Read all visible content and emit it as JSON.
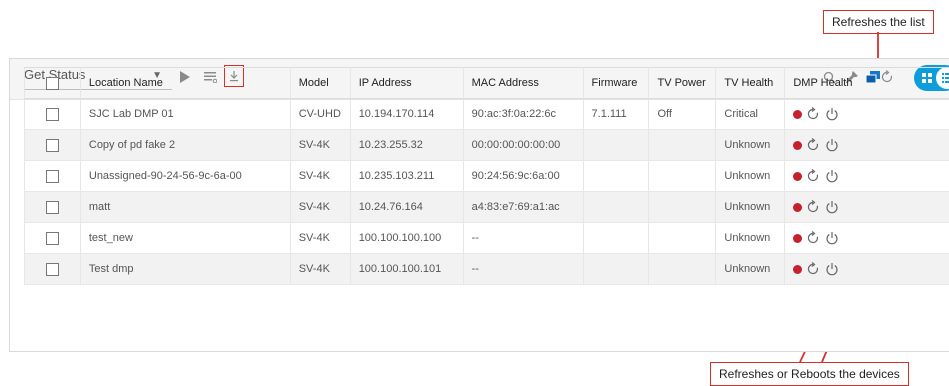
{
  "annotations": {
    "top": "Refreshes the list",
    "bottom": "Refreshes or Reboots the devices"
  },
  "toolbar": {
    "action_select": "Get Status",
    "icons": [
      "play-icon",
      "list-icon",
      "export-icon",
      "search-icon",
      "pin-icon",
      "window-icon",
      "refresh-icon",
      "grid-view-icon",
      "list-view-icon"
    ],
    "accent_color": "#0d9ddb",
    "highlight_color": "#d4312a"
  },
  "table": {
    "columns": [
      "Location Name",
      "Model",
      "IP Address",
      "MAC Address",
      "Firmware",
      "TV Power",
      "TV Health",
      "DMP Health"
    ],
    "rows": [
      {
        "location": "SJC Lab DMP 01",
        "model": "CV-UHD",
        "ip": "10.194.170.114",
        "mac": "90:ac:3f:0a:22:6c",
        "firmware": "7.1.111",
        "tv_power": "Off",
        "tv_health": "Critical"
      },
      {
        "location": "Copy of pd fake 2",
        "model": "SV-4K",
        "ip": "10.23.255.32",
        "mac": "00:00:00:00:00:00",
        "firmware": "",
        "tv_power": "",
        "tv_health": "Unknown"
      },
      {
        "location": "Unassigned-90-24-56-9c-6a-00",
        "model": "SV-4K",
        "ip": "10.235.103.211",
        "mac": "90:24:56:9c:6a:00",
        "firmware": "",
        "tv_power": "",
        "tv_health": "Unknown"
      },
      {
        "location": "matt",
        "model": "SV-4K",
        "ip": "10.24.76.164",
        "mac": "a4:83:e7:69:a1:ac",
        "firmware": "",
        "tv_power": "",
        "tv_health": "Unknown"
      },
      {
        "location": "test_new",
        "model": "SV-4K",
        "ip": "100.100.100.100",
        "mac": "--",
        "firmware": "",
        "tv_power": "",
        "tv_health": "Unknown"
      },
      {
        "location": "Test dmp",
        "model": "SV-4K",
        "ip": "100.100.100.101",
        "mac": "--",
        "firmware": "",
        "tv_power": "",
        "tv_health": "Unknown"
      }
    ],
    "dmp_health_status_color": "#c5202b",
    "dmp_health_icons": [
      "status-dot-icon",
      "refresh-icon",
      "power-icon"
    ]
  }
}
